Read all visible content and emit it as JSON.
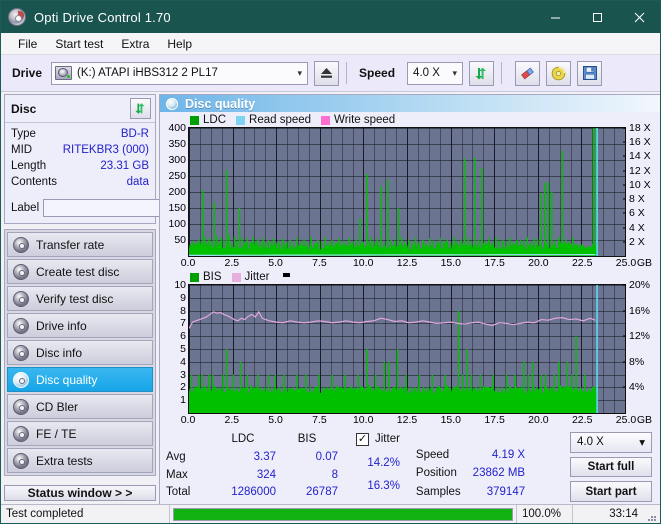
{
  "window": {
    "title": "Opti Drive Control 1.70",
    "app_icon": "disc-icon",
    "minimize": "minimize-icon",
    "maximize": "maximize-icon",
    "close": "close-icon"
  },
  "menu": [
    {
      "label": "File"
    },
    {
      "label": "Start test"
    },
    {
      "label": "Extra"
    },
    {
      "label": "Help"
    }
  ],
  "toolbar": {
    "drive_label": "Drive",
    "drive_value": "(K:)  ATAPI iHBS312  2 PL17",
    "eject_icon": "eject-icon",
    "speed_label": "Speed",
    "speed_value": "4.0 X",
    "refresh_icon": "refresh-icon",
    "erase_icon": "eraser-icon",
    "disc_tools_icon": "gold-disc-icon",
    "save_icon": "save-floppy-icon"
  },
  "disc_panel": {
    "title": "Disc",
    "refresh_icon": "refresh-icon",
    "rows": [
      {
        "key": "Type",
        "value": "BD-R"
      },
      {
        "key": "MID",
        "value": "RITEKBR3 (000)"
      },
      {
        "key": "Length",
        "value": "23.31 GB"
      },
      {
        "key": "Contents",
        "value": "data"
      }
    ],
    "label_key": "Label",
    "label_value": "",
    "label_placeholder": "",
    "label_button_icon": "gold-disc-icon"
  },
  "sidebar": {
    "items": [
      {
        "label": "Transfer rate",
        "active": false
      },
      {
        "label": "Create test disc",
        "active": false
      },
      {
        "label": "Verify test disc",
        "active": false
      },
      {
        "label": "Drive info",
        "active": false
      },
      {
        "label": "Disc info",
        "active": false
      },
      {
        "label": "Disc quality",
        "active": true
      },
      {
        "label": "CD Bler",
        "active": false
      },
      {
        "label": "FE / TE",
        "active": false
      },
      {
        "label": "Extra tests",
        "active": false
      }
    ],
    "status_window_label": "Status window > >"
  },
  "content": {
    "title": "Disc quality",
    "icon": "disc-quality-icon"
  },
  "chart_data": [
    {
      "id": "ldc-chart",
      "type": "line",
      "title": "LDC",
      "xlabel": "GB",
      "ylabel": "",
      "xlim": [
        0,
        25
      ],
      "ylim": [
        0,
        400
      ],
      "y2lim": [
        0,
        18
      ],
      "y2label": "X",
      "grid": true,
      "legend": [
        {
          "label": "LDC",
          "color": "#00a000"
        },
        {
          "label": "Read speed",
          "color": "#7fd3f2"
        },
        {
          "label": "Write speed",
          "color": "#ff6fd0"
        }
      ],
      "xticks": [
        "0.0",
        "2.5",
        "5.0",
        "7.5",
        "10.0",
        "12.5",
        "15.0",
        "17.5",
        "20.0",
        "22.5",
        "25.0"
      ],
      "yticks": [
        50,
        100,
        150,
        200,
        250,
        300,
        350,
        400
      ],
      "y2ticks": [
        "2 X",
        "4 X",
        "6 X",
        "8 X",
        "10 X",
        "12 X",
        "14 X",
        "16 X",
        "18 X"
      ],
      "series": [
        {
          "name": "LDC",
          "color": "#00c000",
          "kind": "spikes",
          "x": [
            0.1,
            0.25,
            0.4,
            0.55,
            0.7,
            0.8,
            0.9,
            1.0,
            1.15,
            1.3,
            1.45,
            1.6,
            1.7,
            1.85,
            2.0,
            2.15,
            2.3,
            2.45,
            2.6,
            2.75,
            2.9,
            3.05,
            3.2,
            3.35,
            3.5,
            3.65,
            3.8,
            3.95,
            4.1,
            4.25,
            4.4,
            4.55,
            4.7,
            4.85,
            5.0,
            5.2,
            5.4,
            5.6,
            5.8,
            6.0,
            6.2,
            6.4,
            6.6,
            6.8,
            7.0,
            7.2,
            7.4,
            7.6,
            7.8,
            8.0,
            8.2,
            8.4,
            8.6,
            8.8,
            9.0,
            9.2,
            9.4,
            9.6,
            9.8,
            10.0,
            10.2,
            10.4,
            10.6,
            10.8,
            11.0,
            11.2,
            11.4,
            11.6,
            11.8,
            12.0,
            12.2,
            12.4,
            12.6,
            12.8,
            13.0,
            13.2,
            13.4,
            13.6,
            13.8,
            14.0,
            14.2,
            14.4,
            14.6,
            14.8,
            15.0,
            15.2,
            15.4,
            15.6,
            15.8,
            16.0,
            16.2,
            16.4,
            16.6,
            16.8,
            17.0,
            17.2,
            17.4,
            17.6,
            17.8,
            18.0,
            18.2,
            18.4,
            18.6,
            18.8,
            19.0,
            19.2,
            19.4,
            19.6,
            19.8,
            20.0,
            20.2,
            20.4,
            20.6,
            20.8,
            21.0,
            21.2,
            21.4,
            21.6,
            21.8,
            22.0,
            22.2,
            22.4,
            22.6,
            22.8,
            23.0,
            23.2,
            23.35
          ],
          "values": [
            38,
            48,
            40,
            52,
            44,
            205,
            60,
            42,
            55,
            48,
            168,
            62,
            44,
            58,
            50,
            268,
            66,
            42,
            60,
            48,
            150,
            58,
            44,
            55,
            42,
            60,
            46,
            52,
            44,
            58,
            42,
            50,
            44,
            56,
            42,
            48,
            54,
            44,
            50,
            42,
            58,
            46,
            52,
            44,
            60,
            42,
            50,
            46,
            58,
            44,
            52,
            42,
            56,
            48,
            44,
            58,
            46,
            52,
            118,
            44,
            256,
            60,
            48,
            54,
            218,
            44,
            238,
            52,
            48,
            150,
            60,
            44,
            52,
            46,
            58,
            44,
            50,
            42,
            56,
            48,
            44,
            58,
            46,
            52,
            44,
            60,
            48,
            52,
            305,
            58,
            46,
            308,
            52,
            275,
            48,
            56,
            44,
            60,
            48,
            52,
            46,
            58,
            44,
            50,
            52,
            48,
            60,
            44,
            56,
            52,
            196,
            228,
            232,
            200,
            48,
            60,
            328,
            52,
            44,
            58,
            40,
            36,
            34,
            30,
            28
          ]
        },
        {
          "name": "Read speed",
          "color": "#9fdff8",
          "kind": "line",
          "x": [
            0.0,
            0.6,
            1.2,
            1.8,
            2.4,
            3.0,
            3.6,
            4.2,
            4.8,
            5.4,
            6.0,
            6.6,
            7.2,
            7.8,
            8.4,
            9.0,
            9.6,
            10.2,
            10.8,
            11.4,
            12.0,
            12.6,
            13.2,
            13.8,
            14.4,
            15.0,
            15.6,
            16.2,
            16.8,
            17.4,
            18.0,
            18.6,
            19.2,
            19.8,
            20.4,
            21.0,
            21.6,
            22.2,
            22.8,
            23.3
          ],
          "values": [
            1.95,
            2.0,
            2.05,
            2.2,
            2.25,
            2.4,
            2.5,
            2.55,
            2.65,
            2.7,
            2.72,
            2.78,
            2.85,
            2.9,
            2.95,
            3.0,
            3.05,
            3.2,
            3.3,
            3.35,
            3.4,
            3.45,
            3.5,
            3.55,
            3.6,
            3.62,
            3.65,
            3.7,
            3.75,
            3.82,
            3.85,
            3.88,
            3.9,
            3.95,
            4.0,
            4.05,
            4.1,
            4.15,
            4.18,
            4.19
          ]
        },
        {
          "name": "Write speed",
          "color": "#ff6fd0",
          "kind": "line",
          "x": [],
          "values": []
        }
      ],
      "cursor_x": 23.4,
      "cursor_color": "#5fd7f7"
    },
    {
      "id": "bis-chart",
      "type": "line",
      "title": "BIS",
      "xlabel": "GB",
      "xlim": [
        0,
        25
      ],
      "ylim": [
        0,
        10
      ],
      "y2lim": [
        0,
        20
      ],
      "y2label": "%",
      "grid": true,
      "legend": [
        {
          "label": "BIS",
          "color": "#00a000"
        },
        {
          "label": "Jitter",
          "color": "#e8aede"
        }
      ],
      "xticks": [
        "0.0",
        "2.5",
        "5.0",
        "7.5",
        "10.0",
        "12.5",
        "15.0",
        "17.5",
        "20.0",
        "22.5",
        "25.0"
      ],
      "yticks": [
        1,
        2,
        3,
        4,
        5,
        6,
        7,
        8,
        9,
        10
      ],
      "y2ticks": [
        "4%",
        "8%",
        "12%",
        "16%",
        "20%"
      ],
      "series": [
        {
          "name": "BIS",
          "color": "#00c000",
          "kind": "spikes",
          "baseline": 2,
          "x": [
            0.15,
            0.35,
            0.55,
            0.75,
            0.95,
            1.15,
            1.35,
            1.55,
            1.75,
            1.95,
            2.15,
            2.35,
            2.55,
            2.75,
            2.95,
            3.15,
            3.35,
            3.55,
            3.75,
            3.95,
            4.15,
            4.35,
            4.55,
            4.75,
            4.95,
            5.2,
            5.45,
            5.7,
            5.95,
            6.2,
            6.45,
            6.7,
            6.95,
            7.2,
            7.45,
            7.7,
            7.95,
            8.2,
            8.45,
            8.7,
            8.95,
            9.2,
            9.45,
            9.7,
            9.95,
            10.2,
            10.45,
            10.7,
            10.95,
            11.2,
            11.45,
            11.7,
            11.95,
            12.2,
            12.45,
            12.7,
            12.95,
            13.2,
            13.45,
            13.7,
            13.95,
            14.2,
            14.45,
            14.7,
            14.95,
            15.2,
            15.45,
            15.7,
            15.95,
            16.2,
            16.45,
            16.7,
            16.95,
            17.2,
            17.45,
            17.7,
            17.95,
            18.2,
            18.45,
            18.7,
            18.95,
            19.2,
            19.45,
            19.7,
            19.95,
            20.2,
            20.45,
            20.7,
            20.95,
            21.2,
            21.45,
            21.7,
            21.95,
            22.2,
            22.45,
            22.7,
            22.95,
            23.2,
            23.35
          ],
          "values": [
            3,
            2,
            3,
            3,
            2,
            3,
            3,
            2,
            2,
            3,
            5,
            2,
            3,
            2,
            4,
            2,
            3,
            2,
            2,
            3,
            2,
            2,
            3,
            2,
            3,
            2,
            3,
            2,
            2,
            3,
            2,
            3,
            2,
            2,
            3,
            2,
            2,
            3,
            2,
            2,
            3,
            2,
            2,
            3,
            2,
            5,
            2,
            3,
            2,
            4,
            4,
            2,
            5,
            2,
            3,
            2,
            2,
            3,
            2,
            2,
            3,
            2,
            2,
            3,
            2,
            2,
            8,
            3,
            5,
            3,
            2,
            3,
            2,
            2,
            3,
            2,
            2,
            3,
            2,
            3,
            2,
            4,
            3,
            4,
            2,
            3,
            3,
            2,
            3,
            4,
            2,
            4,
            3,
            6,
            2,
            3,
            2,
            2,
            2
          ]
        },
        {
          "name": "Jitter",
          "color": "#e0a8d8",
          "kind": "line",
          "x": [
            0.0,
            0.2,
            0.4,
            0.6,
            0.8,
            1.0,
            1.2,
            1.4,
            1.6,
            1.8,
            2.0,
            2.2,
            2.4,
            2.6,
            2.8,
            3.0,
            3.2,
            3.4,
            3.6,
            3.8,
            4.0,
            4.2,
            4.4,
            4.6,
            4.8,
            5.0,
            5.4,
            5.8,
            6.2,
            6.6,
            7.0,
            7.4,
            7.8,
            8.2,
            8.6,
            9.0,
            9.4,
            9.8,
            10.2,
            10.6,
            11.0,
            11.4,
            11.8,
            12.2,
            12.6,
            13.0,
            13.4,
            13.8,
            14.2,
            14.6,
            15.0,
            15.4,
            15.8,
            16.2,
            16.6,
            17.0,
            17.4,
            17.8,
            18.2,
            18.6,
            19.0,
            19.4,
            19.8,
            20.2,
            20.6,
            21.0,
            21.4,
            21.8,
            22.2,
            22.6,
            23.0,
            23.3
          ],
          "values": [
            6.6,
            7.1,
            7.2,
            7.3,
            7.4,
            7.5,
            7.7,
            7.9,
            7.8,
            7.85,
            7.7,
            7.6,
            7.45,
            7.3,
            7.2,
            7.4,
            7.3,
            7.55,
            7.7,
            7.5,
            7.9,
            7.4,
            7.3,
            7.2,
            7.15,
            7.1,
            7.05,
            7.2,
            7.1,
            7.05,
            7.1,
            7.2,
            7.15,
            7.05,
            7.1,
            7.2,
            7.1,
            7.05,
            7.15,
            7.2,
            7.4,
            7.3,
            7.15,
            7.2,
            7.05,
            7.1,
            7.2,
            7.1,
            7.0,
            7.05,
            7.1,
            7.0,
            6.95,
            7.05,
            7.1,
            6.95,
            6.85,
            7.05,
            7.0,
            6.9,
            7.0,
            7.1,
            7.05,
            7.3,
            7.25,
            7.4,
            7.45,
            7.3,
            7.35,
            7.2,
            7.4,
            7.25
          ]
        }
      ],
      "cursor_x": 23.4,
      "cursor_color": "#5fd7f7"
    }
  ],
  "stats": {
    "col_headers": [
      "LDC",
      "BIS"
    ],
    "rows": [
      {
        "label": "Avg",
        "ldc": "3.37",
        "bis": "0.07",
        "jitter": "14.2%"
      },
      {
        "label": "Max",
        "ldc": "324",
        "bis": "8",
        "jitter": "16.3%"
      },
      {
        "label": "Total",
        "ldc": "1286000",
        "bis": "26787",
        "jitter": ""
      }
    ],
    "jitter_label": "Jitter",
    "jitter_checked": true,
    "jitter_checkmark": "✓",
    "speed_label": "Speed",
    "speed_value": "4.19 X",
    "position_label": "Position",
    "position_value": "23862 MB",
    "samples_label": "Samples",
    "samples_value": "379147",
    "speed_select": "4.0 X",
    "start_full_label": "Start full",
    "start_part_label": "Start part"
  },
  "statusbar": {
    "message": "Test completed",
    "progress_percent": "100.0%",
    "progress_value": 100,
    "elapsed": "33:14"
  }
}
